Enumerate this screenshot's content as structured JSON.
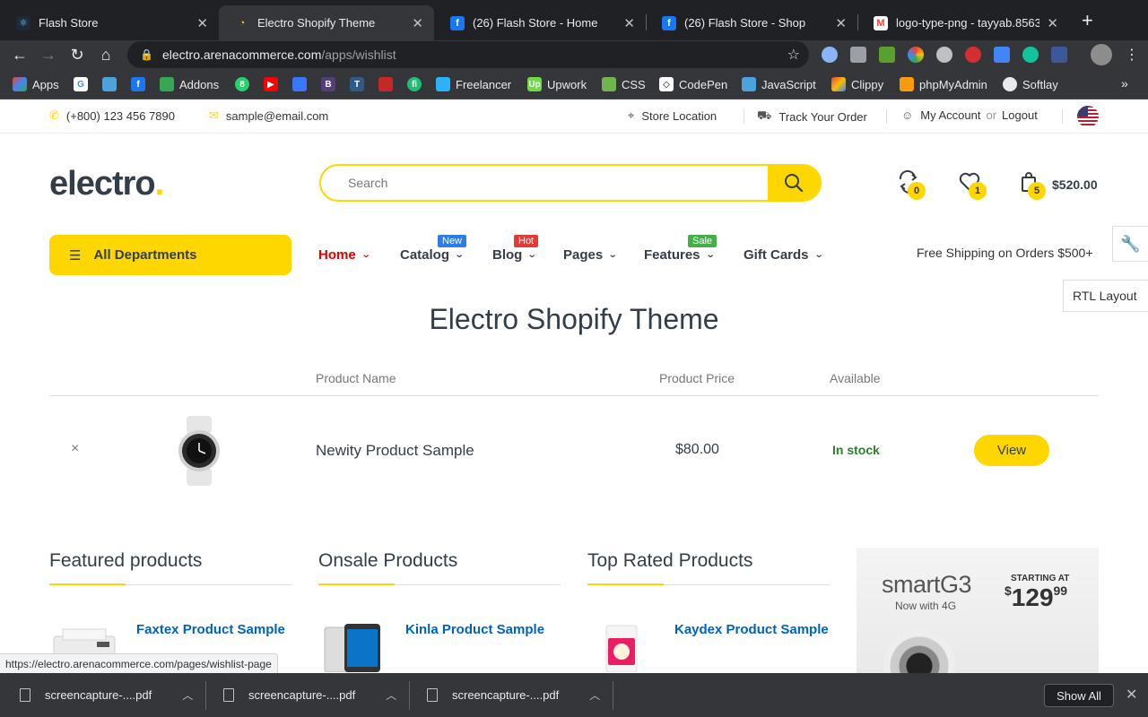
{
  "browser": {
    "tabs": [
      {
        "title": "Flash Store",
        "icon": "react-icon",
        "color": "#61dafb"
      },
      {
        "title": "Electro Shopify Theme",
        "icon": "loading-icon",
        "color": "#fed700"
      },
      {
        "title": "(26) Flash Store - Home",
        "icon": "facebook-icon",
        "color": "#1877f2"
      },
      {
        "title": "(26) Flash Store - Shop",
        "icon": "facebook-icon",
        "color": "#1877f2"
      },
      {
        "title": "logo-type-png - tayyab.8563",
        "icon": "gmail-icon",
        "color": "#ea4335"
      }
    ],
    "url_host": "electro.arenacommerce.com",
    "url_path": "/apps/wishlist",
    "bookmarks": [
      {
        "label": "Apps",
        "icon": "apps-grid-icon"
      },
      {
        "label": "",
        "icon": "google-icon"
      },
      {
        "label": "",
        "icon": "bird-icon"
      },
      {
        "label": "",
        "icon": "facebook-icon"
      },
      {
        "label": "Addons",
        "icon": "puzzle-icon"
      },
      {
        "label": "",
        "icon": "whatsapp-icon"
      },
      {
        "label": "",
        "icon": "youtube-icon"
      },
      {
        "label": "",
        "icon": "olx-icon"
      },
      {
        "label": "",
        "icon": "bootstrap-icon"
      },
      {
        "label": "",
        "icon": "t-icon"
      },
      {
        "label": "",
        "icon": "car-icon"
      },
      {
        "label": "",
        "icon": "fiverr-icon"
      },
      {
        "label": "Freelancer",
        "icon": "freelancer-icon"
      },
      {
        "label": "Upwork",
        "icon": "upwork-icon"
      },
      {
        "label": "CSS",
        "icon": "css-icon"
      },
      {
        "label": "CodePen",
        "icon": "codepen-icon"
      },
      {
        "label": "JavaScript",
        "icon": "javascript-icon"
      },
      {
        "label": "Clippy",
        "icon": "clippy-icon"
      },
      {
        "label": "phpMyAdmin",
        "icon": "phpmyadmin-icon"
      },
      {
        "label": "Softlay",
        "icon": "globe-icon"
      }
    ],
    "status_url": "https://electro.arenacommerce.com/pages/wishlist-page",
    "downloads": [
      "screencapture-....pdf",
      "screencapture-....pdf",
      "screencapture-....pdf"
    ],
    "show_all": "Show All"
  },
  "topbar": {
    "phone": "(+800) 123 456 7890",
    "email": "sample@email.com",
    "store_location": "Store Location",
    "track_order": "Track Your Order",
    "my_account": "My Account",
    "or": "or",
    "logout": "Logout"
  },
  "header": {
    "logo": "electro",
    "logo_dot": ".",
    "search_placeholder": "Search",
    "compare_count": "0",
    "wishlist_count": "1",
    "cart_count": "5",
    "cart_total": "$520.00"
  },
  "nav": {
    "all_departments": "All Departments",
    "items": [
      {
        "label": "Home",
        "tag": ""
      },
      {
        "label": "Catalog",
        "tag": "New"
      },
      {
        "label": "Blog",
        "tag": "Hot"
      },
      {
        "label": "Pages",
        "tag": ""
      },
      {
        "label": "Features",
        "tag": "Sale"
      },
      {
        "label": "Gift Cards",
        "tag": ""
      }
    ],
    "free_shipping": "Free Shipping on Orders $500+",
    "rtl_layout": "RTL Layout"
  },
  "wishlist": {
    "title": "Electro Shopify Theme",
    "columns": [
      "Product Name",
      "Product Price",
      "Available"
    ],
    "rows": [
      {
        "remove": "×",
        "name": "Newity Product Sample",
        "price": "$80.00",
        "available": "In stock",
        "action": "View"
      }
    ]
  },
  "sections": [
    {
      "title": "Featured products",
      "product": "Faxtex Product Sample"
    },
    {
      "title": "Onsale Products",
      "product": "Kinla Product Sample"
    },
    {
      "title": "Top Rated Products",
      "product": "Kaydex Product Sample"
    }
  ],
  "promo": {
    "brand": "smartG3",
    "subtitle": "Now with 4G",
    "starting_at": "STARTING AT",
    "price_dollar": "$",
    "price_main": "129",
    "price_cents": "99"
  },
  "colors": {
    "accent": "#fed700",
    "heading": "#333e48",
    "link": "#0062bd",
    "in_stock": "#2e7d32",
    "active_menu": "#e00000",
    "tag_new": "#2b7de9",
    "tag_hot": "#e53935",
    "tag_sale": "#43b047"
  }
}
